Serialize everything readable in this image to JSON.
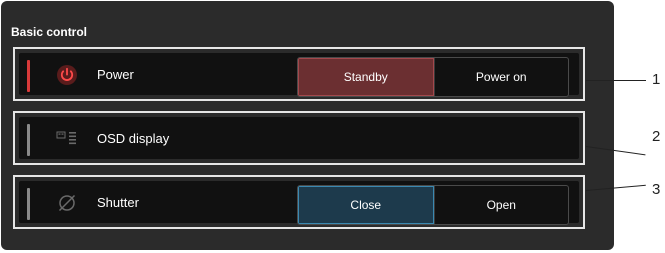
{
  "section": {
    "title": "Basic control"
  },
  "rows": [
    {
      "label": "Power",
      "icon": "power-icon",
      "accent_color": "#d93a3a",
      "options": [
        "Standby",
        "Power on"
      ],
      "selected": "Standby"
    },
    {
      "label": "OSD display",
      "icon": "osd-display-icon",
      "accent_color": "#8a8a8a"
    },
    {
      "label": "Shutter",
      "icon": "shutter-icon",
      "accent_color": "#8a8a8a",
      "options": [
        "Close",
        "Open"
      ],
      "selected": "Close"
    }
  ],
  "callouts": [
    "1",
    "2",
    "3"
  ],
  "colors": {
    "panel_bg": "#2b2b2b",
    "row_bg": "#111111",
    "standby_active": "#6b2f31",
    "close_active": "#1d3a4c"
  }
}
